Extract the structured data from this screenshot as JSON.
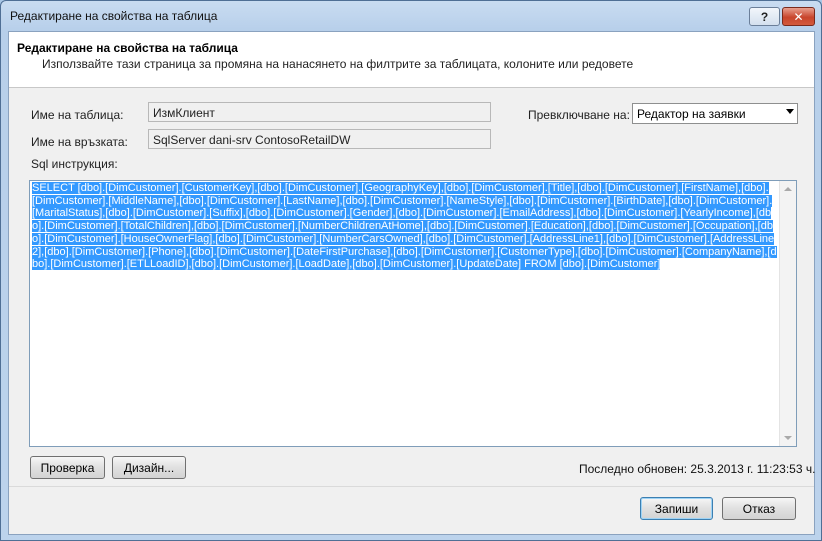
{
  "window": {
    "title": "Редактиране на свойства на таблица",
    "help_label": "?",
    "close_label": "✕"
  },
  "header": {
    "title": "Редактиране на свойства на таблица",
    "subtitle": "Използвайте тази страница за промяна на нанасянето на филтрите за таблицата, колоните или редовете"
  },
  "form": {
    "table_name_label": "Име на таблица:",
    "table_name_value": "ИзмКлиент",
    "connection_label": "Име на връзката:",
    "connection_value": "SqlServer dani-srv ContosoRetailDW",
    "switch_label": "Превключване на:",
    "switch_value": "Редактор на заявки",
    "sql_label": "Sql инструкция:",
    "sql_text": "SELECT [dbo].[DimCustomer].[CustomerKey],[dbo].[DimCustomer].[GeographyKey],[dbo].[DimCustomer].[Title],[dbo].[DimCustomer].[FirstName],[dbo].[DimCustomer].[MiddleName],[dbo].[DimCustomer].[LastName],[dbo].[DimCustomer].[NameStyle],[dbo].[DimCustomer].[BirthDate],[dbo].[DimCustomer].[MaritalStatus],[dbo].[DimCustomer].[Suffix],[dbo].[DimCustomer].[Gender],[dbo].[DimCustomer].[EmailAddress],[dbo].[DimCustomer].[YearlyIncome],[dbo].[DimCustomer].[TotalChildren],[dbo].[DimCustomer].[NumberChildrenAtHome],[dbo].[DimCustomer].[Education],[dbo].[DimCustomer].[Occupation],[dbo].[DimCustomer].[HouseOwnerFlag],[dbo].[DimCustomer].[NumberCarsOwned],[dbo].[DimCustomer].[AddressLine1],[dbo].[DimCustomer].[AddressLine2],[dbo].[DimCustomer].[Phone],[dbo].[DimCustomer].[DateFirstPurchase],[dbo].[DimCustomer].[CustomerType],[dbo].[DimCustomer].[CompanyName],[dbo].[DimCustomer].[ETLLoadID],[dbo].[DimCustomer].[LoadDate],[dbo].[DimCustomer].[UpdateDate]     FROM [dbo].[DimCustomer]"
  },
  "buttons": {
    "validate_label": "Проверка",
    "design_label": "Дизайн...",
    "save_label": "Запиши",
    "cancel_label": "Отказ"
  },
  "status": {
    "last_updated": "Последно обновен: 25.3.2013 г. 11:23:53 ч."
  }
}
